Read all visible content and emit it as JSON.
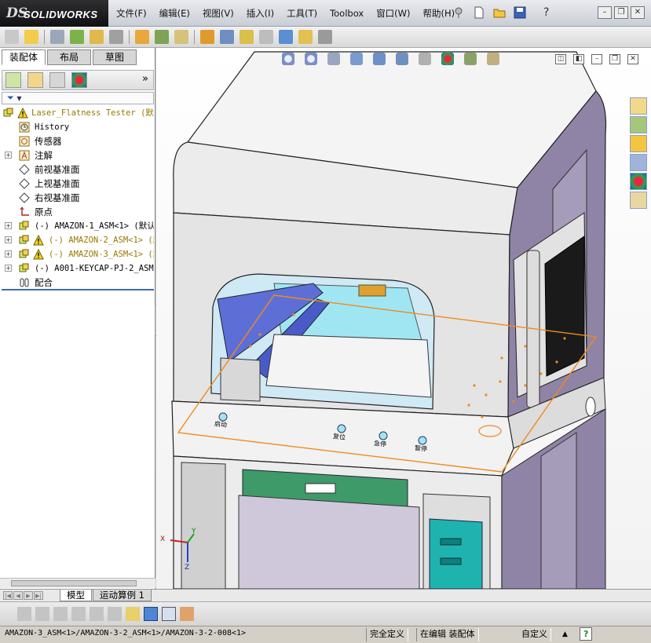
{
  "app": {
    "logo_prefix": "DS",
    "logo_text": "SOLIDWORKS"
  },
  "menu": {
    "items": [
      "文件(F)",
      "编辑(E)",
      "视图(V)",
      "插入(I)",
      "工具(T)",
      "Toolbox",
      "窗口(W)",
      "帮助(H)"
    ],
    "help_symbol": "?"
  },
  "left_tabs": [
    "装配体",
    "布局",
    "草图"
  ],
  "feature_manager": {
    "more_symbol": "»",
    "filter_symbol": "▼",
    "tree": [
      {
        "label": "Laser_Flatness Tester  (默",
        "icon": "assembly-warning-icon",
        "warn": true
      },
      {
        "label": "History",
        "icon": "history-icon"
      },
      {
        "label": "传感器",
        "icon": "sensor-icon"
      },
      {
        "label": "注解",
        "icon": "annotation-icon",
        "expand": "+"
      },
      {
        "label": "前视基准面",
        "icon": "plane-icon"
      },
      {
        "label": "上视基准面",
        "icon": "plane-icon"
      },
      {
        "label": "右视基准面",
        "icon": "plane-icon"
      },
      {
        "label": "原点",
        "icon": "origin-icon"
      },
      {
        "label": "(-) AMAZON-1_ASM<1> (默认<",
        "icon": "subassembly-icon",
        "expand": "+"
      },
      {
        "label": "(-) AMAZON-2_ASM<1> (默",
        "icon": "subassembly-warning-icon",
        "expand": "+",
        "warn": true
      },
      {
        "label": "(-) AMAZON-3_ASM<1> (默",
        "icon": "subassembly-warning-icon",
        "expand": "+",
        "warn": true
      },
      {
        "label": "(-) A001-KEYCAP-PJ-2_ASM<",
        "icon": "subassembly-icon",
        "expand": "+"
      },
      {
        "label": "配合",
        "icon": "mates-icon"
      }
    ]
  },
  "machine_labels": {
    "btn1": "启动",
    "btn2": "复位",
    "btn3": "急停",
    "btn4": "暂停"
  },
  "triad": {
    "x": "X",
    "y": "Y",
    "z": "Z"
  },
  "bottom_tabs": [
    "模型",
    "运动算例 1"
  ],
  "statusbar": {
    "path": "AMAZON-3_ASM<1>/AMAZON-3-2_ASM<1>/AMAZON-3-2-008<1>",
    "definition": "完全定义",
    "editing": "在编辑 装配体",
    "units": "自定义",
    "units_arrow": "▲",
    "help": "?"
  },
  "colors": {
    "accent_blue": "#3a6ea5",
    "selection_orange": "#f08a1c",
    "glass_cyan": "#9fe6f2",
    "machine_purple": "#8f84a6"
  }
}
